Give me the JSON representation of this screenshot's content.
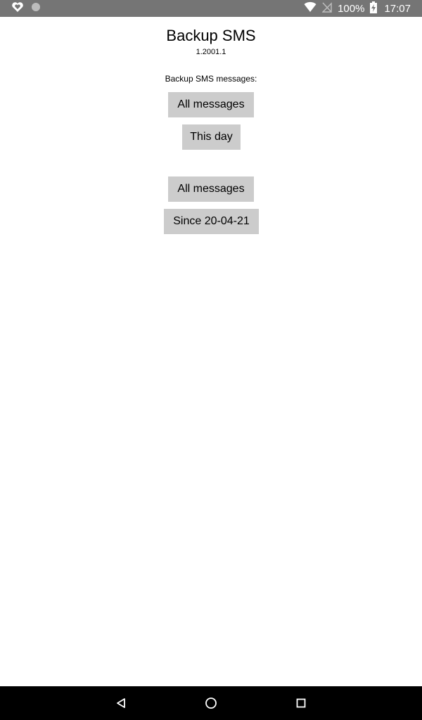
{
  "status_bar": {
    "left_icons": [
      "heart-shield-icon",
      "circle-notification-icon"
    ],
    "right_icons": [
      "wifi-icon",
      "no-signal-icon",
      "battery-charging-icon"
    ],
    "battery_percent": "100%",
    "time": "17:07"
  },
  "app": {
    "title": "Backup SMS",
    "version": "1.2001.1",
    "section_label": "Backup SMS messages:"
  },
  "buttons": {
    "all_messages_1": "All messages",
    "this_day": "This day",
    "all_messages_2": "All messages",
    "since_date": "Since 20-04-21"
  },
  "nav_bar": {
    "items": [
      "back-icon",
      "home-icon",
      "recents-icon"
    ]
  },
  "colors": {
    "status_bar_bg": "#757575",
    "button_bg": "#cccccc",
    "nav_bar_bg": "#000000",
    "page_bg": "#ffffff"
  }
}
